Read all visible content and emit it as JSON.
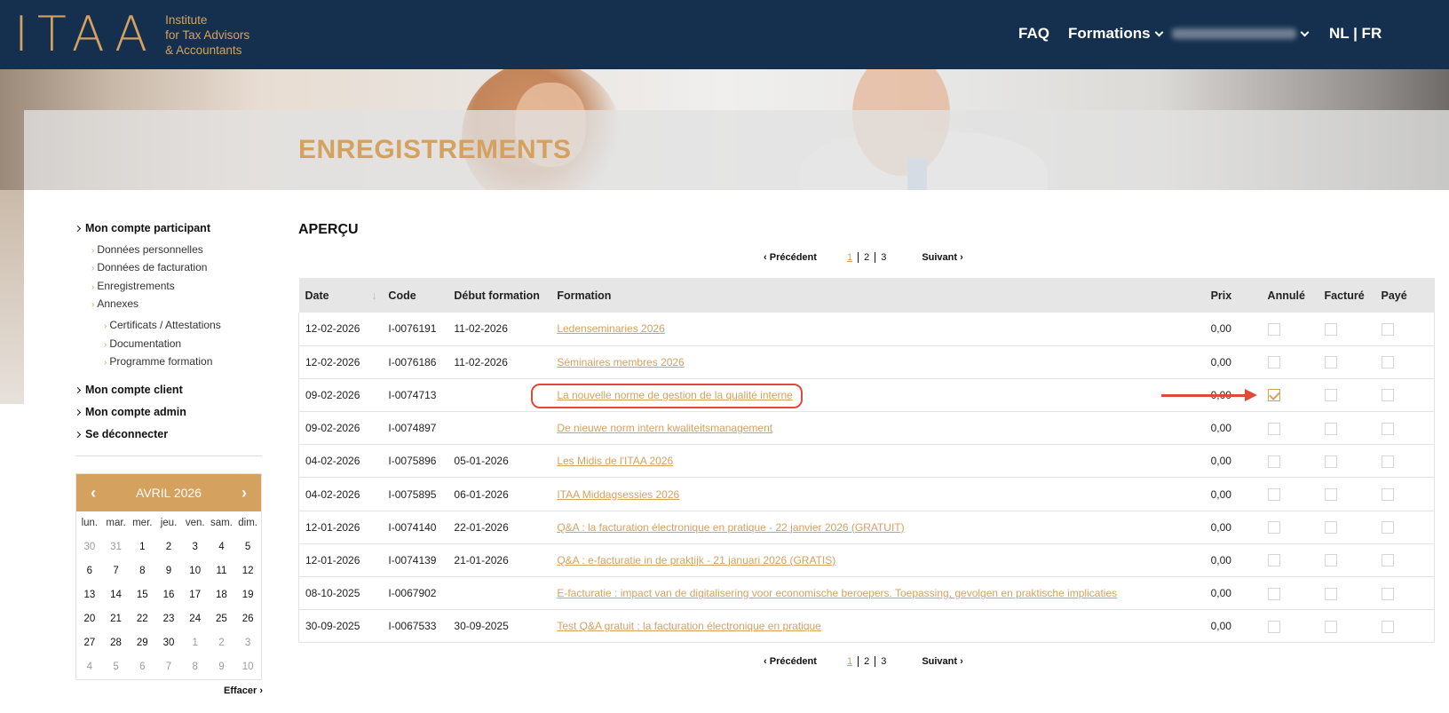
{
  "header": {
    "logo_mark": "ITAA",
    "logo_text_1": "Institute",
    "logo_text_2": "for Tax Advisors",
    "logo_text_3": "& Accountants",
    "nav_faq": "FAQ",
    "nav_formations": "Formations",
    "nav_lang": "NL | FR"
  },
  "page_title": "ENREGISTREMENTS",
  "sidebar": {
    "mon_compte_participant": "Mon compte participant",
    "donnees_personnelles": "Données personnelles",
    "donnees_facturation": "Données de facturation",
    "enregistrements": "Enregistrements",
    "annexes": "Annexes",
    "certificats": "Certificats / Attestations",
    "documentation": "Documentation",
    "programme": "Programme formation",
    "mon_compte_client": "Mon compte client",
    "mon_compte_admin": "Mon compte admin",
    "se_deconnecter": "Se déconnecter"
  },
  "calendar": {
    "month": "AVRIL 2026",
    "weekdays": [
      "lun.",
      "mar.",
      "mer.",
      "jeu.",
      "ven.",
      "sam.",
      "dim."
    ],
    "days": [
      "30",
      "31",
      "1",
      "2",
      "3",
      "4",
      "5",
      "6",
      "7",
      "8",
      "9",
      "10",
      "11",
      "12",
      "13",
      "14",
      "15",
      "16",
      "17",
      "18",
      "19",
      "20",
      "21",
      "22",
      "23",
      "24",
      "25",
      "26",
      "27",
      "28",
      "29",
      "30",
      "1",
      "2",
      "3",
      "4",
      "5",
      "6",
      "7",
      "8",
      "9",
      "10"
    ],
    "clear": "Effacer"
  },
  "main": {
    "apercu": "APERÇU",
    "pager": {
      "prev": "Précédent",
      "next": "Suivant",
      "pages": [
        "1",
        "2",
        "3"
      ],
      "current": "1"
    },
    "columns": {
      "date": "Date",
      "code": "Code",
      "debut": "Début formation",
      "formation": "Formation",
      "prix": "Prix",
      "annule": "Annulé",
      "facture": "Facturé",
      "paye": "Payé"
    },
    "rows": [
      {
        "date": "12-02-2026",
        "code": "I-0076191",
        "debut": "11-02-2026",
        "formation": "Ledenseminaries 2026",
        "prix": "0,00",
        "annule": false,
        "facture": false,
        "paye": false
      },
      {
        "date": "12-02-2026",
        "code": "I-0076186",
        "debut": "11-02-2026",
        "formation": "Séminaires membres 2026",
        "prix": "0,00",
        "annule": false,
        "facture": false,
        "paye": false
      },
      {
        "date": "09-02-2026",
        "code": "I-0074713",
        "debut": "",
        "formation": "La nouvelle norme de gestion de la qualité interne",
        "prix": "0,00",
        "annule": true,
        "facture": false,
        "paye": false
      },
      {
        "date": "09-02-2026",
        "code": "I-0074897",
        "debut": "",
        "formation": "De nieuwe norm intern kwaliteitsmanagement",
        "prix": "0,00",
        "annule": false,
        "facture": false,
        "paye": false
      },
      {
        "date": "04-02-2026",
        "code": "I-0075896",
        "debut": "05-01-2026",
        "formation": "Les Midis de l'ITAA 2026",
        "prix": "0,00",
        "annule": false,
        "facture": false,
        "paye": false
      },
      {
        "date": "04-02-2026",
        "code": "I-0075895",
        "debut": "06-01-2026",
        "formation": "ITAA Middagsessies 2026",
        "prix": "0,00",
        "annule": false,
        "facture": false,
        "paye": false
      },
      {
        "date": "12-01-2026",
        "code": "I-0074140",
        "debut": "22-01-2026",
        "formation": "Q&A : la facturation électronique en pratique - 22 janvier 2026 (GRATUIT)",
        "prix": "0,00",
        "annule": false,
        "facture": false,
        "paye": false
      },
      {
        "date": "12-01-2026",
        "code": "I-0074139",
        "debut": "21-01-2026",
        "formation": "Q&A : e-facturatie in de praktijk - 21 januari 2026 (GRATIS)",
        "prix": "0,00",
        "annule": false,
        "facture": false,
        "paye": false
      },
      {
        "date": "08-10-2025",
        "code": "I-0067902",
        "debut": "",
        "formation": "E-facturatie : impact van de digitalisering voor economische beroepers. Toepassing, gevolgen en praktische implicaties",
        "prix": "0,00",
        "annule": false,
        "facture": false,
        "paye": false
      },
      {
        "date": "30-09-2025",
        "code": "I-0067533",
        "debut": "30-09-2025",
        "formation": "Test Q&A gratuit : la facturation électronique en pratique",
        "prix": "0,00",
        "annule": false,
        "facture": false,
        "paye": false
      }
    ]
  },
  "colors": {
    "navy": "#15304f",
    "gold": "#d4a15f",
    "annotation_red": "#e04a3a"
  }
}
